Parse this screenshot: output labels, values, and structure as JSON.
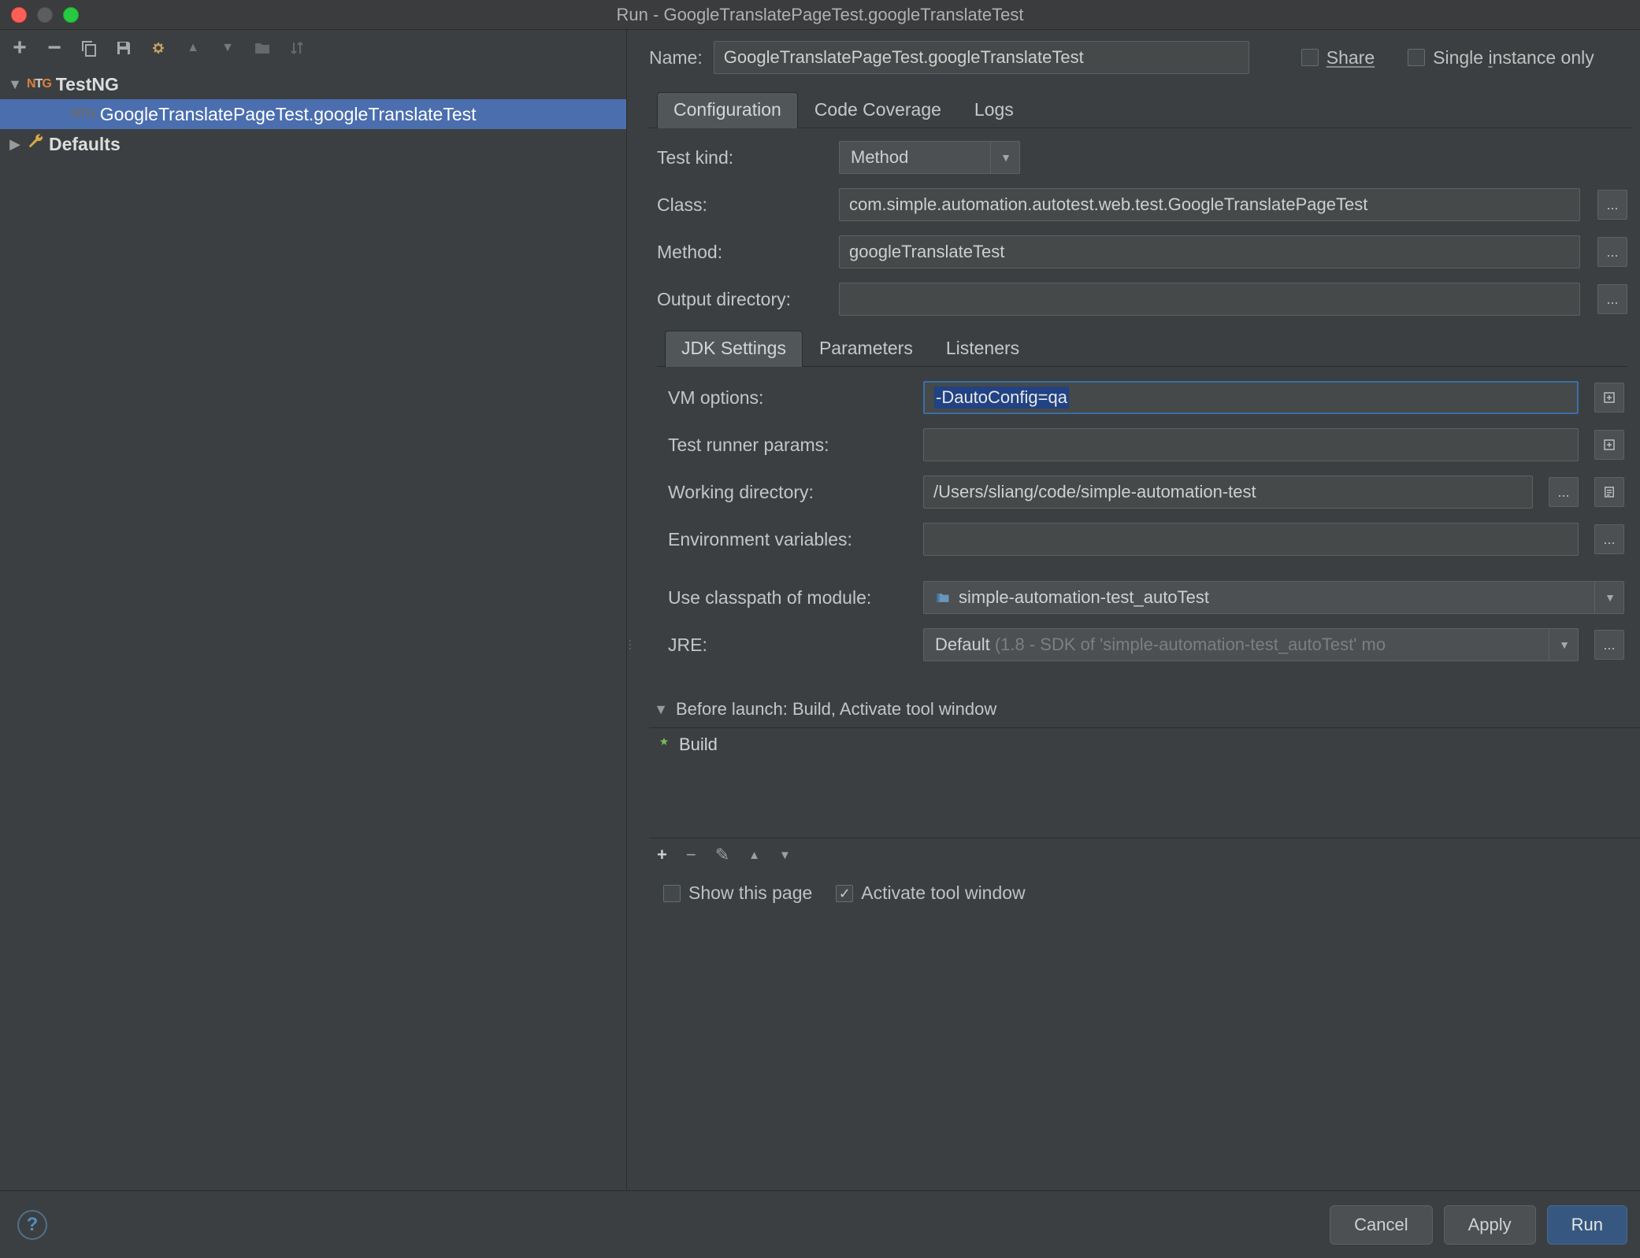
{
  "window": {
    "title": "Run - GoogleTranslatePageTest.googleTranslateTest"
  },
  "tree": {
    "root1": "TestNG",
    "node1": "GoogleTranslatePageTest.googleTranslateTest",
    "root2": "Defaults"
  },
  "name": {
    "label": "Name:",
    "value": "GoogleTranslatePageTest.googleTranslateTest"
  },
  "share": {
    "label": "Share"
  },
  "single": {
    "prefix": "Single ",
    "u": "i",
    "suffix": "nstance only"
  },
  "tabs": {
    "config": "Configuration",
    "cov": "Code Coverage",
    "logs": "Logs"
  },
  "form": {
    "testkind_label": "Test kind:",
    "testkind_value": "Method",
    "class_label": "Class:",
    "class_value": "com.simple.automation.autotest.web.test.GoogleTranslatePageTest",
    "method_label": "Method:",
    "method_value": "googleTranslateTest",
    "outdir_label": "Output directory:"
  },
  "subtabs": {
    "jdk": "JDK Settings",
    "params": "Parameters",
    "listeners": "Listeners"
  },
  "jdk": {
    "vm_label": "VM options:",
    "vm_value": "-DautoConfig=qa",
    "runner_label": "Test runner params:",
    "wd_label": "Working directory:",
    "wd_value": "/Users/sliang/code/simple-automation-test",
    "env_label": "Environment variables:",
    "cp_label": "Use classpath of module:",
    "cp_value": "simple-automation-test_autoTest",
    "jre_label": "JRE:",
    "jre_default": "Default ",
    "jre_detail": "(1.8 - SDK of 'simple-automation-test_autoTest' mo"
  },
  "before": {
    "header": "Before launch: Build, Activate tool window",
    "item": "Build"
  },
  "opts": {
    "show": "Show this page",
    "activate": "Activate tool window"
  },
  "buttons": {
    "cancel": "Cancel",
    "apply": "Apply",
    "run": "Run"
  },
  "ellipsis": "...",
  "caret": "▼",
  "help": "?"
}
